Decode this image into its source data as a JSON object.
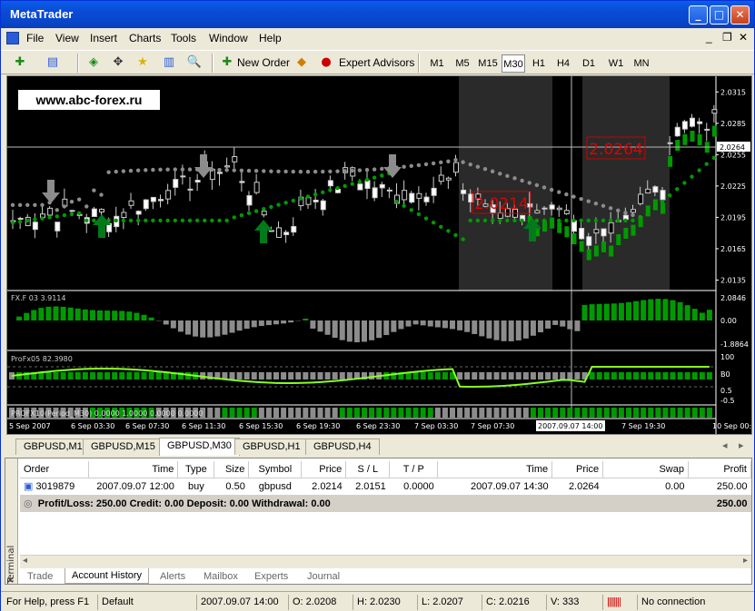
{
  "window": {
    "title": "MetaTrader",
    "min": "_",
    "max": "□",
    "close": "✕"
  },
  "menu": [
    "File",
    "View",
    "Insert",
    "Charts",
    "Tools",
    "Window",
    "Help"
  ],
  "mdi": {
    "min": "_",
    "restore": "❐",
    "close": "✕"
  },
  "toolbar": {
    "new_order": "New Order",
    "expert_advisors": "Expert Advisors",
    "timeframes": [
      "M1",
      "M5",
      "M15",
      "M30",
      "H1",
      "H4",
      "D1",
      "W1",
      "MN"
    ],
    "active_tf": "M30"
  },
  "chart": {
    "watermark": "www.abc-forex.ru",
    "price_labels": [
      "2.0315",
      "2.0285",
      "2.0255",
      "2.0225",
      "2.0195",
      "2.0165",
      "2.0135"
    ],
    "current_price": "2.0264",
    "entry_label": "2.0214",
    "exit_label": "2.0264",
    "ind1": {
      "label": "FX.F 03 3.9114",
      "scale": [
        "2.0846",
        "0.00",
        "-1.8864"
      ]
    },
    "ind2": {
      "label": "ProFx05 82.3980",
      "scale": [
        "100",
        "B0",
        "0.5",
        "-0.5"
      ]
    },
    "ind3": {
      "label": "PROFX10(Period_M30) 0.0000 1.0000 0.0000 0.0000"
    },
    "time_labels": [
      "5 Sep 2007",
      "6 Sep 03:30",
      "6 Sep 07:30",
      "6 Sep 11:30",
      "6 Sep 15:30",
      "6 Sep 19:30",
      "6 Sep 23:30",
      "7 Sep 03:30",
      "7 Sep 07:30",
      "2007.09.07 14:00",
      "7 Sep 19:30",
      "10 Sep 00:3"
    ]
  },
  "chart_tabs": [
    "GBPUSD,M1",
    "GBPUSD,M15",
    "GBPUSD,M30",
    "GBPUSD,H1",
    "GBPUSD,H4"
  ],
  "active_chart_tab": "GBPUSD,M30",
  "terminal": {
    "side_label": "Terminal",
    "columns": [
      "Order",
      "Time",
      "Type",
      "Size",
      "Symbol",
      "Price",
      "S / L",
      "T / P",
      "Time",
      "Price",
      "Swap",
      "Profit"
    ],
    "rows": [
      [
        "3019879",
        "2007.09.07 12:00",
        "buy",
        "0.50",
        "gbpusd",
        "2.0214",
        "2.0151",
        "0.0000",
        "2007.09.07 14:30",
        "2.0264",
        "0.00",
        "250.00"
      ]
    ],
    "summary": {
      "text": "Profit/Loss: 250.00  Credit: 0.00  Deposit: 0.00  Withdrawal: 0.00",
      "total": "250.00"
    },
    "tabs": [
      "Trade",
      "Account History",
      "Alerts",
      "Mailbox",
      "Experts",
      "Journal"
    ],
    "active_tab": "Account History"
  },
  "status": {
    "help": "For Help, press F1",
    "profile": "Default",
    "time": "2007.09.07 14:00",
    "open": "O: 2.0208",
    "high": "H: 2.0230",
    "low": "L: 2.0207",
    "close": "C: 2.0216",
    "volume": "V: 333",
    "connection": "No connection"
  },
  "colors": {
    "accent_green": "#00a000",
    "up_arrow": "#007a1a",
    "down_arrow": "#8c8c8c",
    "trade_box": "#cc0000"
  }
}
